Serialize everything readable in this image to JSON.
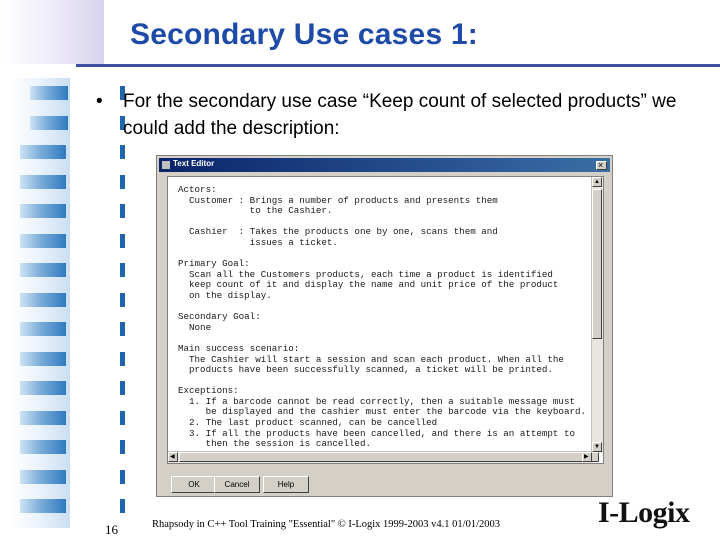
{
  "slide": {
    "title": "Secondary Use cases 1:",
    "bullet_marker": "•",
    "bullet_text": "For the secondary use case “Keep count of selected products” we could add the description:"
  },
  "editor": {
    "window_title": "Text Editor",
    "close_glyph": "×",
    "content": "Actors:\n  Customer : Brings a number of products and presents them\n             to the Cashier.\n\n  Cashier  : Takes the products one by one, scans them and\n             issues a ticket.\n\nPrimary Goal:\n  Scan all the Customers products, each time a product is identified\n  keep count of it and display the name and unit price of the product\n  on the display.\n\nSecondary Goal:\n  None\n\nMain success scenario:\n  The Cashier will start a session and scan each product. When all the\n  products have been successfully scanned, a ticket will be printed.\n\nExceptions:\n  1. If a barcode cannot be read correctly, then a suitable message must\n     be displayed and the cashier must enter the barcode via the keyboard.\n  2. The last product scanned, can be cancelled\n  3. If all the products have been cancelled, and there is an attempt to\n     then the session is cancelled.",
    "buttons": {
      "ok": "OK",
      "cancel": "Cancel",
      "help": "Help"
    }
  },
  "footer": {
    "slide_number": "16",
    "text": "Rhapsody in C++ Tool Training \"Essential\"   © I-Logix 1999-2003   v4.1  01/01/2003",
    "logo": "I-Logix"
  }
}
